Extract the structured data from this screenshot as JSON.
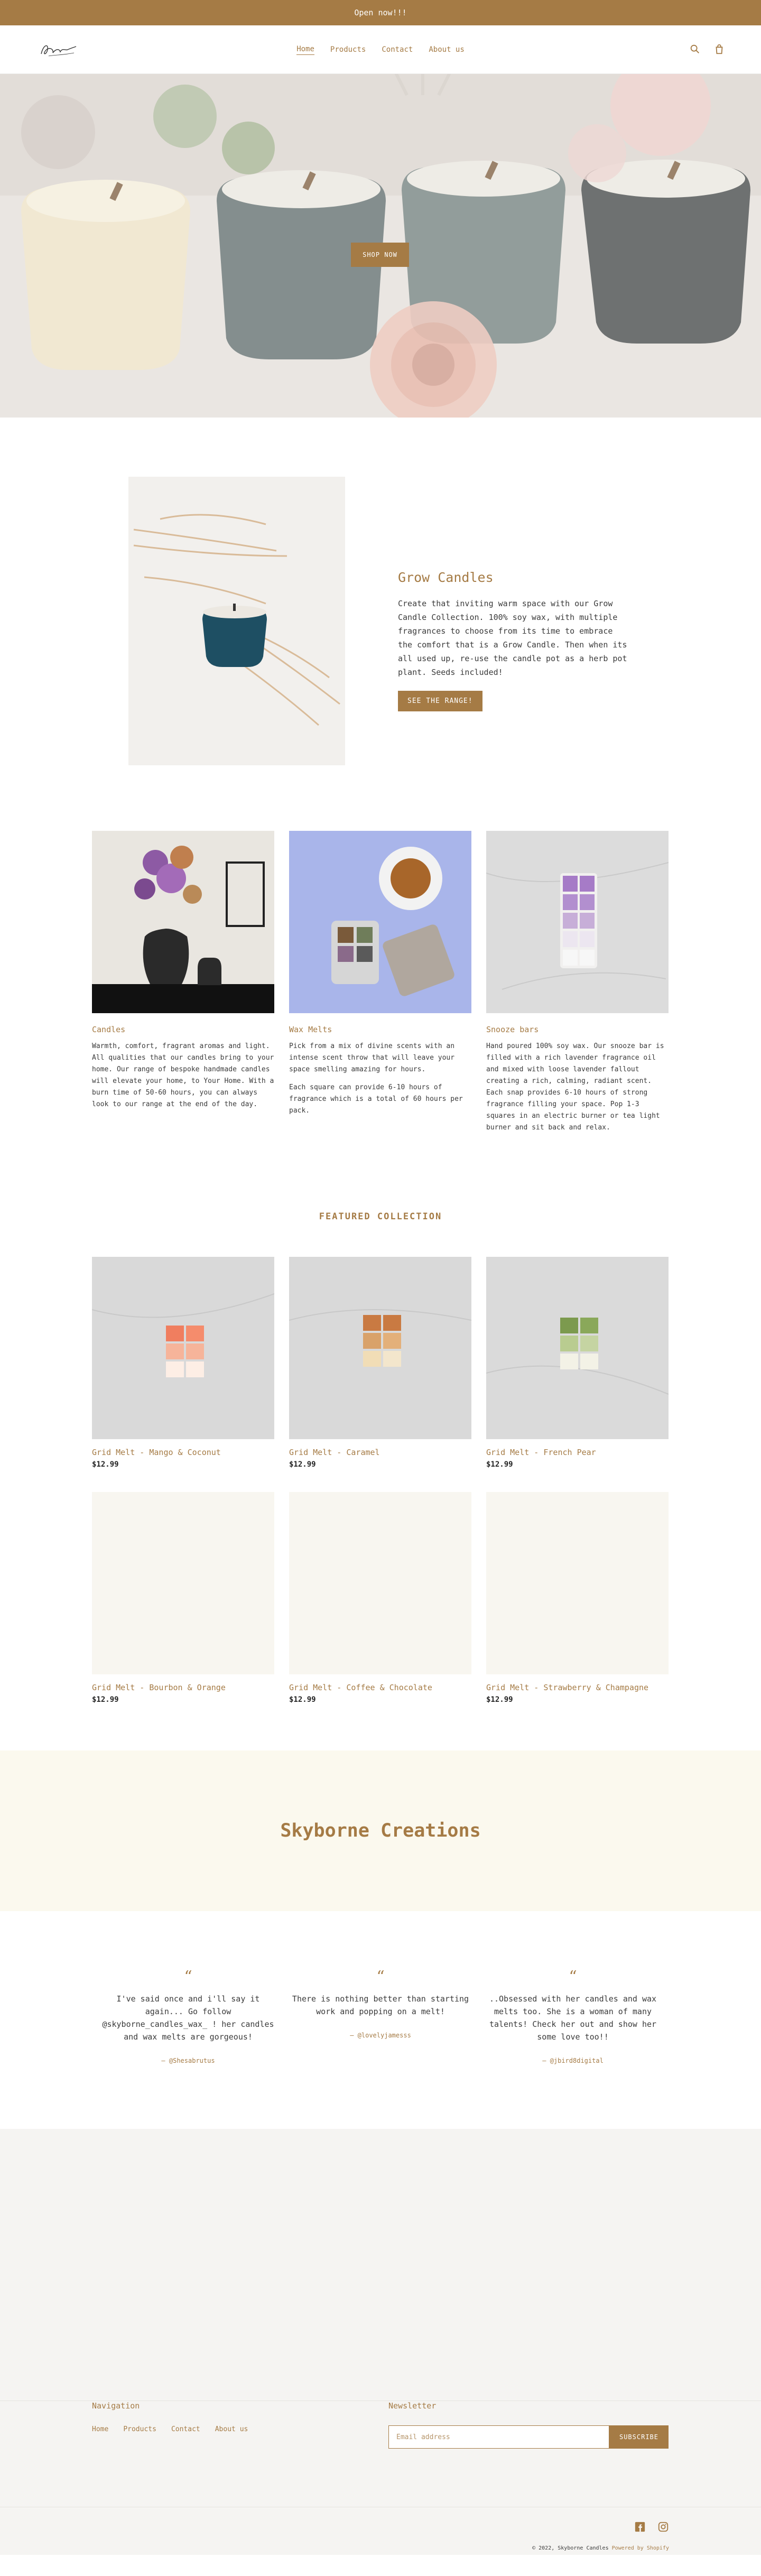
{
  "colors": {
    "accent": "#a57b45",
    "footer_bg": "#f5f4f2",
    "sky_bg": "#fbf9ee"
  },
  "announcement": {
    "text": "Open now!!!"
  },
  "header": {
    "nav": [
      "Home",
      "Products",
      "Contact",
      "About us"
    ],
    "icons": [
      "search-icon",
      "cart-icon"
    ]
  },
  "hero": {
    "button": "SHOP NOW"
  },
  "feature": {
    "title": "Grow Candles",
    "body": "Create that inviting warm space with our Grow Candle Collection. 100% soy wax, with multiple fragrances to choose from its time to embrace the comfort that is a Grow Candle. Then when its all used up, re-use the candle pot as a herb pot plant. Seeds included!",
    "button": "SEE THE RANGE!"
  },
  "columns": [
    {
      "title": "Candles",
      "paragraphs": [
        "Warmth, comfort, fragrant aromas and light. All qualities that our candles bring to your home. Our range of bespoke handmade candles will elevate your home, to Your Home. With a burn time of 50-60 hours, you can always look to our range at the end of the day."
      ]
    },
    {
      "title": "Wax Melts",
      "paragraphs": [
        "Pick from a mix of divine scents with an intense scent throw that will leave your space smelling amazing for hours.",
        "Each square can provide 6-10 hours of fragrance which is a total of 60 hours per pack."
      ]
    },
    {
      "title": "Snooze bars",
      "paragraphs": [
        "Hand poured 100% soy wax. Our snooze bar is filled with a rich lavender fragrance oil and mixed with loose lavender fallout creating a rich, calming, radiant scent. Each snap provides 6-10 hours of strong fragrance filling your space. Pop 1-3 squares in an electric burner or tea light burner and sit back and relax."
      ]
    }
  ],
  "featured_collection": {
    "title": "FEATURED COLLECTION",
    "products": [
      {
        "name": "Grid Melt - Mango & Coconut",
        "price": "$12.99",
        "swatch": "#f08a6a"
      },
      {
        "name": "Grid Melt - Caramel",
        "price": "$12.99",
        "swatch": "#c98a4e"
      },
      {
        "name": "Grid Melt - French Pear",
        "price": "$12.99",
        "swatch": "#8aa65a"
      },
      {
        "name": "Grid Melt - Bourbon & Orange",
        "price": "$12.99",
        "swatch": ""
      },
      {
        "name": "Grid Melt - Coffee & Chocolate",
        "price": "$12.99",
        "swatch": ""
      },
      {
        "name": "Grid Melt - Strawberry & Champagne",
        "price": "$12.99",
        "swatch": ""
      }
    ]
  },
  "brand": {
    "title": "Skyborne Creations"
  },
  "testimonials": [
    {
      "text": "I've said once and i'll say it again... Go follow @skyborne_candles_wax_ ! her candles and wax melts are gorgeous!",
      "author": "— @Shesabrutus"
    },
    {
      "text": "There is nothing better than starting work and popping on a melt!",
      "author": "— @lovelyjamesss"
    },
    {
      "text": "..Obsessed with her candles and wax melts too. She is a woman of many talents! Check her out and show her some love too!!",
      "author": "— @jbird8digital"
    }
  ],
  "footer": {
    "nav_title": "Navigation",
    "nav": [
      "Home",
      "Products",
      "Contact",
      "About us"
    ],
    "newsletter_title": "Newsletter",
    "email_placeholder": "Email address",
    "subscribe": "SUBSCRIBE",
    "social": [
      "facebook-icon",
      "instagram-icon"
    ],
    "copyright": "© 2022, Skyborne Candles",
    "powered": "Powered by Shopify"
  }
}
